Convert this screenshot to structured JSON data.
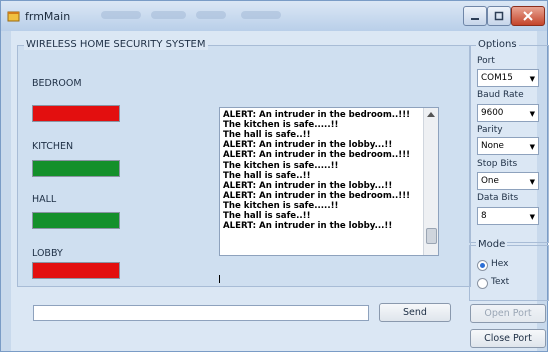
{
  "window": {
    "title": "frmMain",
    "controls": [
      "minimize-icon",
      "maximize-icon",
      "close-icon"
    ]
  },
  "main": {
    "group_title": "WIRELESS HOME SECURITY SYSTEM",
    "rooms": [
      {
        "label": "BEDROOM",
        "status_color": "#e30f0f"
      },
      {
        "label": "KITCHEN",
        "status_color": "#14902b"
      },
      {
        "label": "HALL",
        "status_color": "#14902b"
      },
      {
        "label": "LOBBY",
        "status_color": "#e30f0f"
      }
    ],
    "log_lines": [
      "ALERT: An intruder in the bedroom..!!!",
      "The kitchen is safe.....!!",
      "The hall is safe..!!",
      "ALERT: An intruder in the lobby...!!",
      "ALERT: An intruder in the bedroom..!!!",
      "The kitchen is safe.....!!",
      "The hall is safe..!!",
      "ALERT: An intruder in the lobby...!!",
      "ALERT: An intruder in the bedroom..!!!",
      "The kitchen is safe.....!!",
      "The hall is safe..!!",
      "ALERT: An intruder in the lobby...!!"
    ],
    "send_input_value": "",
    "send_label": "Send"
  },
  "options": {
    "group_title": "Options",
    "port": {
      "label": "Port",
      "value": "COM15"
    },
    "baud": {
      "label": "Baud Rate",
      "value": "9600"
    },
    "parity": {
      "label": "Parity",
      "value": "None"
    },
    "stop_bits": {
      "label": "Stop Bits",
      "value": "One"
    },
    "data_bits": {
      "label": "Data Bits",
      "value": "8"
    }
  },
  "mode": {
    "group_title": "Mode",
    "hex_label": "Hex",
    "text_label": "Text",
    "selected": "Hex"
  },
  "buttons": {
    "open_port": "Open Port",
    "close_port": "Close Port"
  },
  "colors": {
    "alert": "#e30f0f",
    "safe": "#14902b"
  }
}
